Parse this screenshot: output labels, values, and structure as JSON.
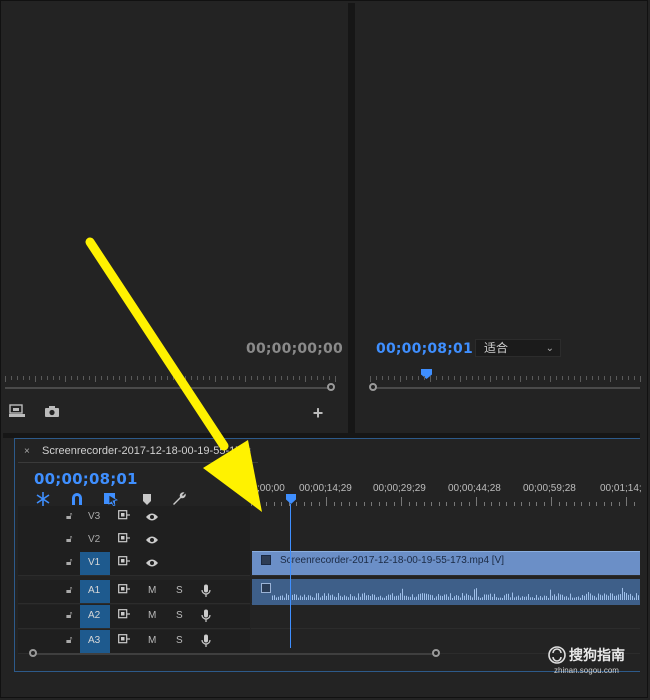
{
  "source_monitor": {
    "timecode": "00;00;00;00"
  },
  "program_monitor": {
    "timecode": "00;00;08;01",
    "fit_select": "适合"
  },
  "timeline": {
    "close_glyph": "×",
    "sequence_name": "Screenrecorder-2017-12-18-00-19-55-173",
    "menu_glyph": "≡",
    "timecode": "00;00;08;01",
    "ruler_labels": [
      ";00;00",
      "00;00;14;29",
      "00;00;29;29",
      "00;00;44;28",
      "00;00;59;28",
      "00;01;14;"
    ],
    "tracks": [
      {
        "name": "V3",
        "targeted": false,
        "kind": "video"
      },
      {
        "name": "V2",
        "targeted": false,
        "kind": "video"
      },
      {
        "name": "V1",
        "targeted": true,
        "kind": "video"
      },
      {
        "name": "A1",
        "targeted": true,
        "kind": "audio"
      },
      {
        "name": "A2",
        "targeted": true,
        "kind": "audio"
      },
      {
        "name": "A3",
        "targeted": true,
        "kind": "audio"
      }
    ],
    "mute_label": "M",
    "solo_label": "S",
    "video_clip_label": "Screenrecorder-2017-12-18-00-19-55-173.mp4 [V]"
  },
  "watermark": {
    "text": "搜狗指南",
    "sub": "zhinan.sogou.com"
  },
  "colors": {
    "accent_blue": "#3f8fff",
    "arrow_yellow": "#fff200",
    "work_area": "#d8c33a",
    "video_clip": "#6b8fc7",
    "audio_clip": "#3e5f89"
  },
  "icons": [
    "export-frame-icon",
    "camera-icon",
    "plus-icon",
    "snap-icon",
    "magnet-icon",
    "linked-selection-icon",
    "marker-icon",
    "wrench-icon",
    "lock-icon",
    "eye-icon",
    "mic-icon",
    "film-icon"
  ]
}
